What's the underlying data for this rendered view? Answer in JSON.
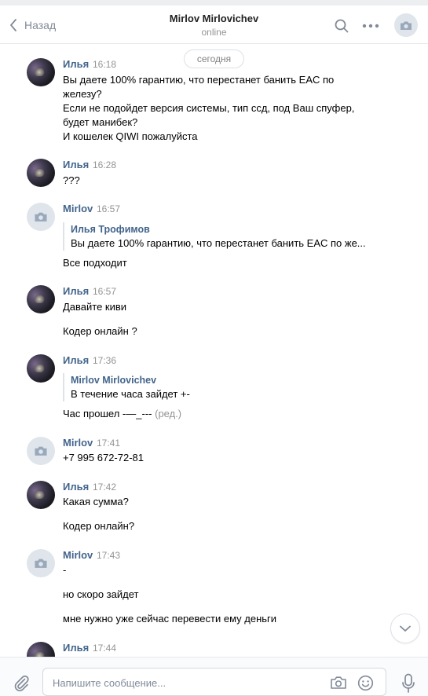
{
  "header": {
    "back_label": "Назад",
    "title": "Mirlov Mirlovichev",
    "status": "online"
  },
  "date_separator": "сегодня",
  "messages": [
    {
      "author": "Илья",
      "time": "16:18",
      "lines": [
        "Вы даете 100% гарантию, что перестанет банить EAC по",
        "железу?",
        "Если не подойдет версия системы, тип ссд, под Ваш спуфер,",
        "будет манибек?",
        "И кошелек QIWI пожалуйста"
      ]
    },
    {
      "author": "Илья",
      "time": "16:28",
      "lines": [
        "???"
      ]
    },
    {
      "author": "Mirlov",
      "time": "16:57",
      "quote": {
        "name": "Илья Трофимов",
        "text": "Вы даете 100% гарантию, что перестанет банить EAC по же..."
      },
      "lines": [
        "Все подходит"
      ]
    },
    {
      "author": "Илья",
      "time": "16:57",
      "lines": [
        "Давайте киви",
        "Кодер онлайн ?"
      ]
    },
    {
      "author": "Илья",
      "time": "17:36",
      "quote": {
        "name": "Mirlov Mirlovichev",
        "text": "В течение часа зайдет +-"
      },
      "lines": [
        "Час прошел -—_---"
      ],
      "edited": "(ред.)"
    },
    {
      "author": "Mirlov",
      "time": "17:41",
      "lines": [
        "+7 995 672-72-81"
      ]
    },
    {
      "author": "Илья",
      "time": "17:42",
      "lines": [
        "Какая сумма?",
        "Кодер онлайн?"
      ]
    },
    {
      "author": "Mirlov",
      "time": "17:43",
      "lines": [
        "-",
        "но скоро зайдет",
        "мне нужно уже сейчас перевести ему деньги"
      ]
    },
    {
      "author": "Илья",
      "time": "17:44",
      "lines": []
    }
  ],
  "composer": {
    "placeholder": "Напишите сообщение..."
  },
  "icons": {
    "back": "chevron-left-icon",
    "search": "search-icon",
    "more": "more-dots-icon",
    "avatar_placeholder": "camera-icon",
    "attach": "paperclip-icon",
    "camera": "camera-icon",
    "emoji": "smile-icon",
    "voice": "microphone-icon",
    "scroll": "chevron-down-icon"
  },
  "colors": {
    "link": "#42648b",
    "muted": "#939393",
    "icon": "#828a99"
  }
}
